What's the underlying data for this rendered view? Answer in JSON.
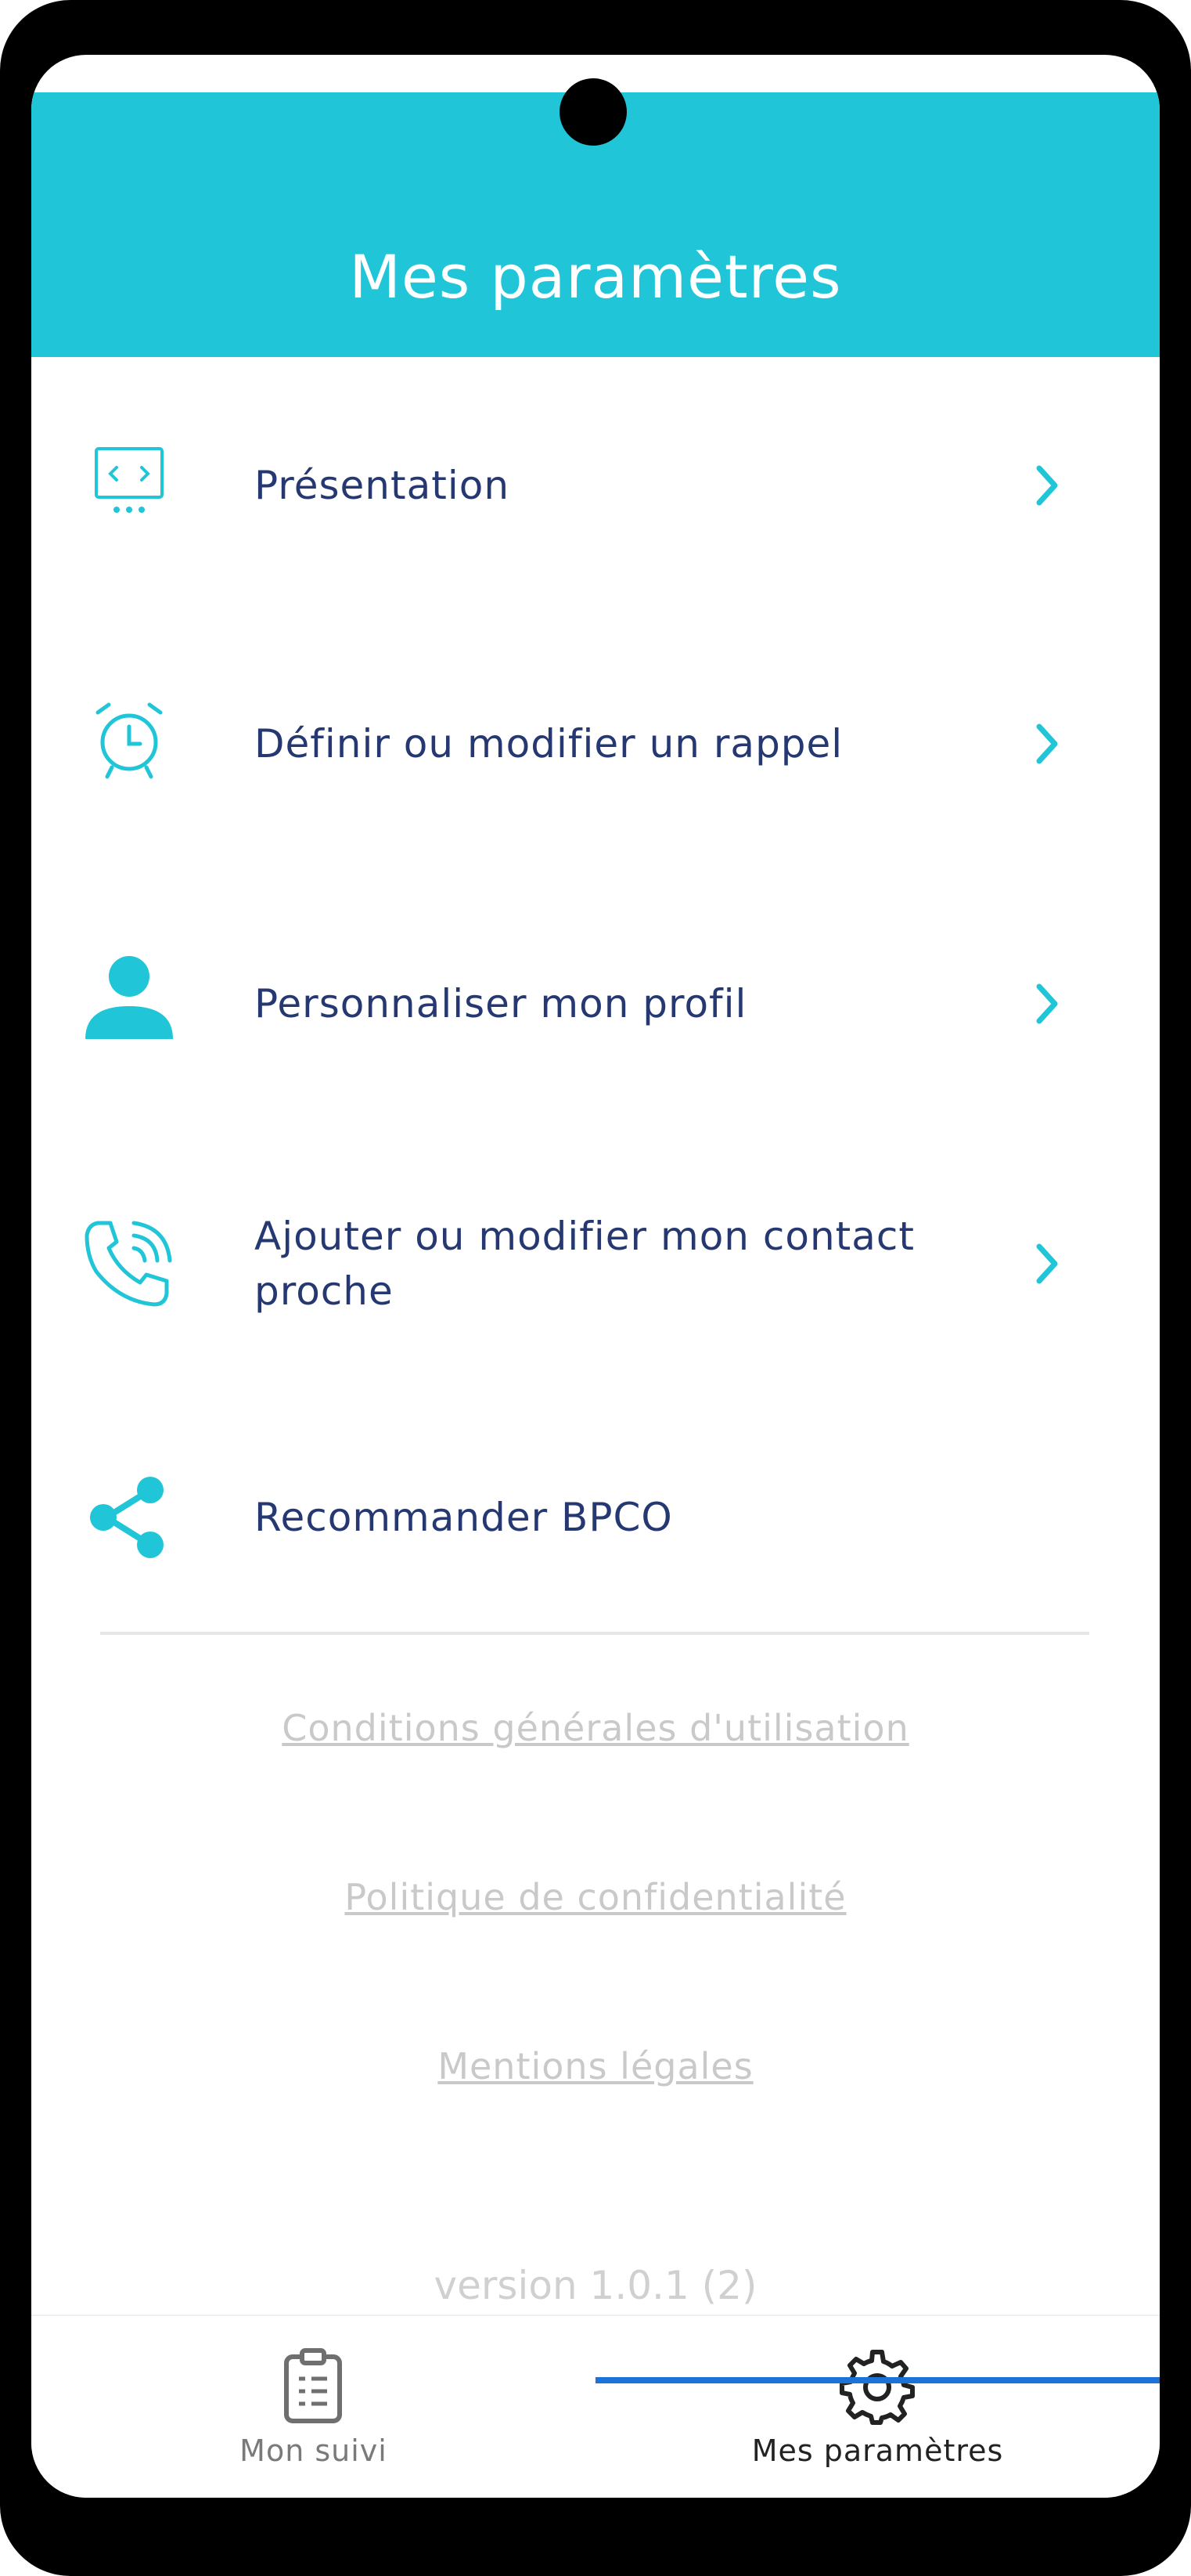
{
  "header": {
    "title": "Mes paramètres"
  },
  "menu": {
    "items": [
      {
        "label": "Présentation",
        "icon": "presentation-icon",
        "has_chevron": true
      },
      {
        "label": "Définir ou modifier un rappel",
        "icon": "alarm-clock-icon",
        "has_chevron": true
      },
      {
        "label": "Personnaliser mon profil",
        "icon": "user-icon",
        "has_chevron": true
      },
      {
        "label": "Ajouter ou modifier mon contact proche",
        "icon": "phone-call-icon",
        "has_chevron": true
      },
      {
        "label": "Recommander BPCO",
        "icon": "share-icon",
        "has_chevron": false
      }
    ]
  },
  "legal": {
    "terms": "Conditions générales d'utilisation",
    "privacy": "Politique de confidentialité",
    "mentions": "Mentions légales"
  },
  "version": "version 1.0.1 (2)",
  "tabs": [
    {
      "label": "Mon suivi",
      "icon": "clipboard-icon",
      "active": false
    },
    {
      "label": "Mes paramètres",
      "icon": "gear-icon",
      "active": true
    }
  ],
  "colors": {
    "accent": "#20c6d7",
    "text_primary": "#253872",
    "link_muted": "#c9c9c9",
    "tab_indicator": "#1d72d6"
  }
}
